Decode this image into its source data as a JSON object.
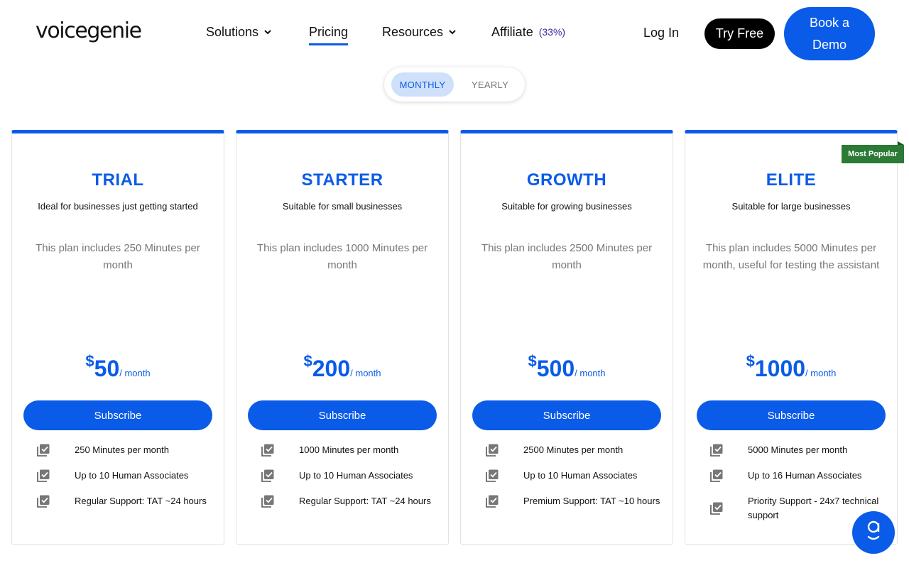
{
  "header": {
    "logo_text": "voicegenie",
    "nav": [
      {
        "label": "Solutions",
        "has_dropdown": true
      },
      {
        "label": "Pricing",
        "active": true
      },
      {
        "label": "Resources",
        "has_dropdown": true
      },
      {
        "label": "Affiliate",
        "badge": "(33%)"
      }
    ],
    "login_label": "Log In",
    "try_free_label": "Try Free",
    "book_demo_label": "Book a Demo"
  },
  "billing_toggle": {
    "options": [
      "MONTHLY",
      "YEARLY"
    ],
    "selected": "MONTHLY"
  },
  "plans": [
    {
      "name": "TRIAL",
      "subtitle": "Ideal for businesses just getting started",
      "description": "This plan includes 250 Minutes per month",
      "currency": "$",
      "price": "50",
      "period": "/ month",
      "cta": "Subscribe",
      "features": [
        "250 Minutes per month",
        "Up to 10 Human Associates",
        "Regular Support: TAT ~24 hours"
      ]
    },
    {
      "name": "STARTER",
      "subtitle": "Suitable for small businesses",
      "description": "This plan includes 1000 Minutes per month",
      "currency": "$",
      "price": "200",
      "period": "/ month",
      "cta": "Subscribe",
      "features": [
        "1000 Minutes per month",
        "Up to 10 Human Associates",
        "Regular Support: TAT ~24 hours"
      ]
    },
    {
      "name": "GROWTH",
      "subtitle": "Suitable for growing businesses",
      "description": "This plan includes 2500 Minutes per month",
      "currency": "$",
      "price": "500",
      "period": "/ month",
      "cta": "Subscribe",
      "features": [
        "2500 Minutes per month",
        "Up to 10 Human Associates",
        "Premium Support: TAT ~10 hours"
      ]
    },
    {
      "name": "ELITE",
      "subtitle": "Suitable for large businesses",
      "description": "This plan includes 5000 Minutes per month, useful for testing the assistant",
      "currency": "$",
      "price": "1000",
      "period": "/ month",
      "cta": "Subscribe",
      "badge": "Most Popular",
      "features": [
        "5000 Minutes per month",
        "Up to 16 Human Associates",
        "Priority Support - 24x7 technical support"
      ]
    }
  ],
  "icons": {
    "feature": "checkbox-stack-icon",
    "dropdown": "chevron-down-icon",
    "chat": "chat-assistant-icon"
  },
  "colors": {
    "brand_blue": "#0a5be8",
    "badge_green": "#2b7a36",
    "toggle_selected_bg": "#cfe0fb",
    "text_muted": "#777777"
  }
}
